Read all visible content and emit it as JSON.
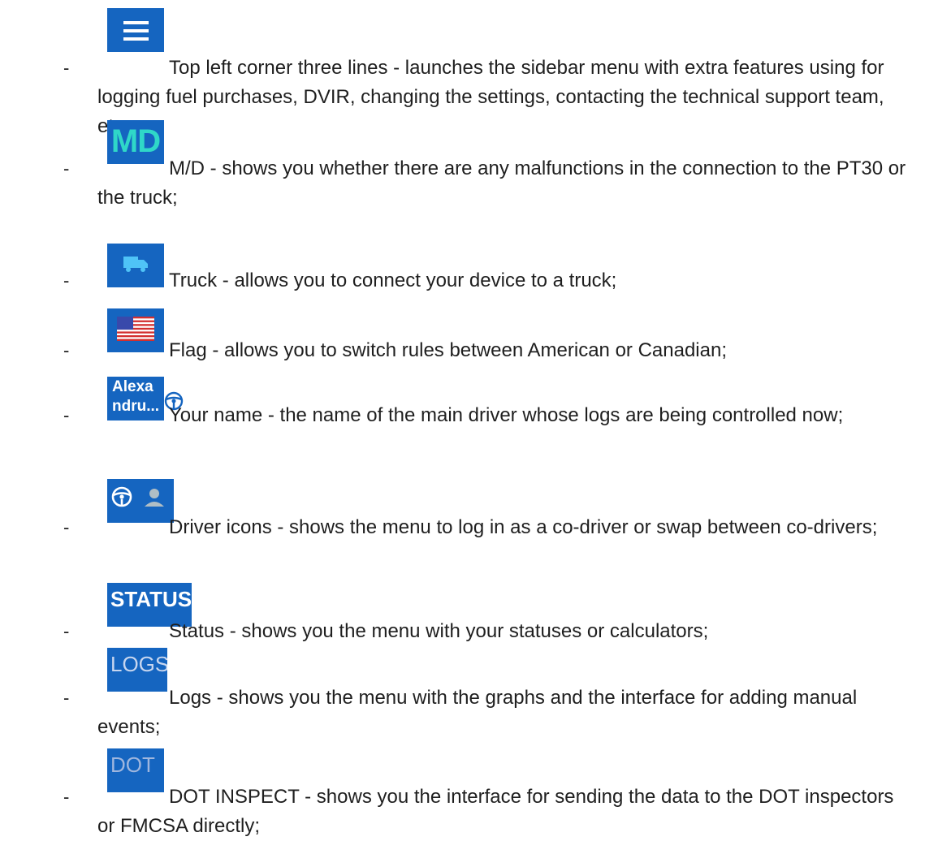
{
  "bullet": "-",
  "items": [
    {
      "icon": "menu-icon",
      "text": "Top left corner three lines - launches the sidebar menu with extra features using for logging fuel purchases, DVIR, changing the settings, contacting the technical support team, etc.;"
    },
    {
      "icon": "md-icon",
      "icon_text": "MD",
      "text": "M/D - shows you whether there are any malfunctions in the connection to the PT30 or the truck;"
    },
    {
      "icon": "truck-icon",
      "text": "Truck - allows you to connect your device to a truck;"
    },
    {
      "icon": "us-flag-icon",
      "text": "Flag - allows you to switch rules between American or Canadian;"
    },
    {
      "icon": "driver-name-icon",
      "icon_text_1": "Alexa",
      "icon_text_2": "ndru...",
      "text": "Your name - the name of the main driver whose logs are being controlled now;"
    },
    {
      "icon": "driver-icons",
      "text": "Driver icons - shows the menu to log in as a co-driver or swap between co-drivers;"
    },
    {
      "icon": "status-tab-icon",
      "icon_text": "STATUS",
      "text": "Status - shows you the menu with your statuses or calculators;"
    },
    {
      "icon": "logs-tab-icon",
      "icon_text": "LOGS",
      "text": "Logs - shows you the menu with the graphs and the interface for adding manual events;"
    },
    {
      "icon": "dot-tab-icon",
      "icon_text": "DOT",
      "text": "DOT INSPECT - shows you the interface for sending the data to the DOT inspectors or FMCSA directly;"
    }
  ],
  "colors": {
    "icon_bg": "#1565c0",
    "md_text": "#2fd8c8",
    "truck": "#4fc3f7"
  }
}
